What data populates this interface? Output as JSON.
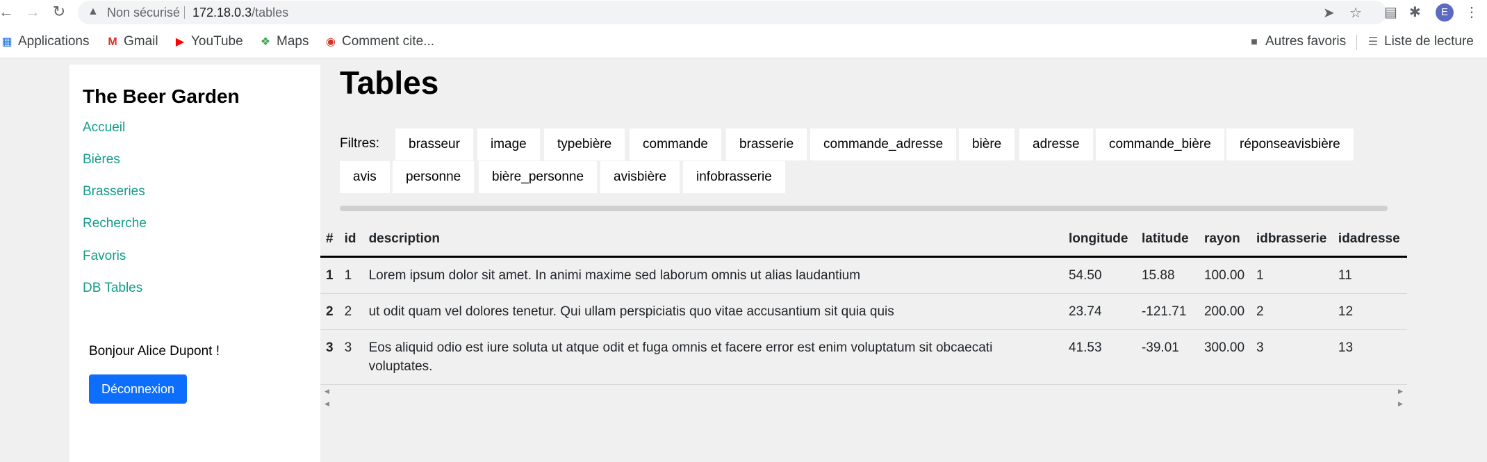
{
  "browser": {
    "security_label": "Non sécurisé",
    "url_host": "172.18.0.3",
    "url_path": "/tables",
    "profile_initial": "E",
    "bookmarks": [
      {
        "label": "Applications",
        "icon": "apps-grid-icon"
      },
      {
        "label": "Gmail",
        "icon": "gmail-icon"
      },
      {
        "label": "YouTube",
        "icon": "youtube-icon"
      },
      {
        "label": "Maps",
        "icon": "maps-icon"
      },
      {
        "label": "Comment cite...",
        "icon": "bookmark-site-icon"
      }
    ],
    "other_bookmarks": "Autres favoris",
    "reading_list": "Liste de lecture"
  },
  "sidebar": {
    "brand": "The Beer Garden",
    "links": [
      "Accueil",
      "Bières",
      "Brasseries",
      "Recherche",
      "Favoris",
      "DB Tables"
    ],
    "greeting": "Bonjour Alice Dupont !",
    "logout_label": "Déconnexion",
    "link_color": "#139c8a"
  },
  "main": {
    "title": "Tables",
    "filters_label": "Filtres:",
    "filters": [
      "brasseur",
      "image",
      "typebière",
      "commande",
      "brasserie",
      "commande_adresse",
      "bière",
      "adresse",
      "commande_bière",
      "réponseavisbière",
      "avis",
      "personne",
      "bière_personne",
      "avisbière",
      "infobrasserie"
    ]
  },
  "table": {
    "headers": [
      "#",
      "id",
      "description",
      "longitude",
      "latitude",
      "rayon",
      "idbrasserie",
      "idadresse"
    ],
    "rows": [
      [
        "1",
        "1",
        "Lorem ipsum dolor sit amet. In animi maxime sed laborum omnis ut alias laudantium",
        "54.50",
        "15.88",
        "100.00",
        "1",
        "11"
      ],
      [
        "2",
        "2",
        "ut odit quam vel dolores tenetur. Qui ullam perspiciatis quo vitae accusantium sit quia quis",
        "23.74",
        "-121.71",
        "200.00",
        "2",
        "12"
      ],
      [
        "3",
        "3",
        "Eos aliquid odio est iure soluta ut atque odit et fuga omnis et facere error est enim voluptatum sit obcaecati voluptates.",
        "41.53",
        "-39.01",
        "300.00",
        "3",
        "13"
      ]
    ]
  }
}
